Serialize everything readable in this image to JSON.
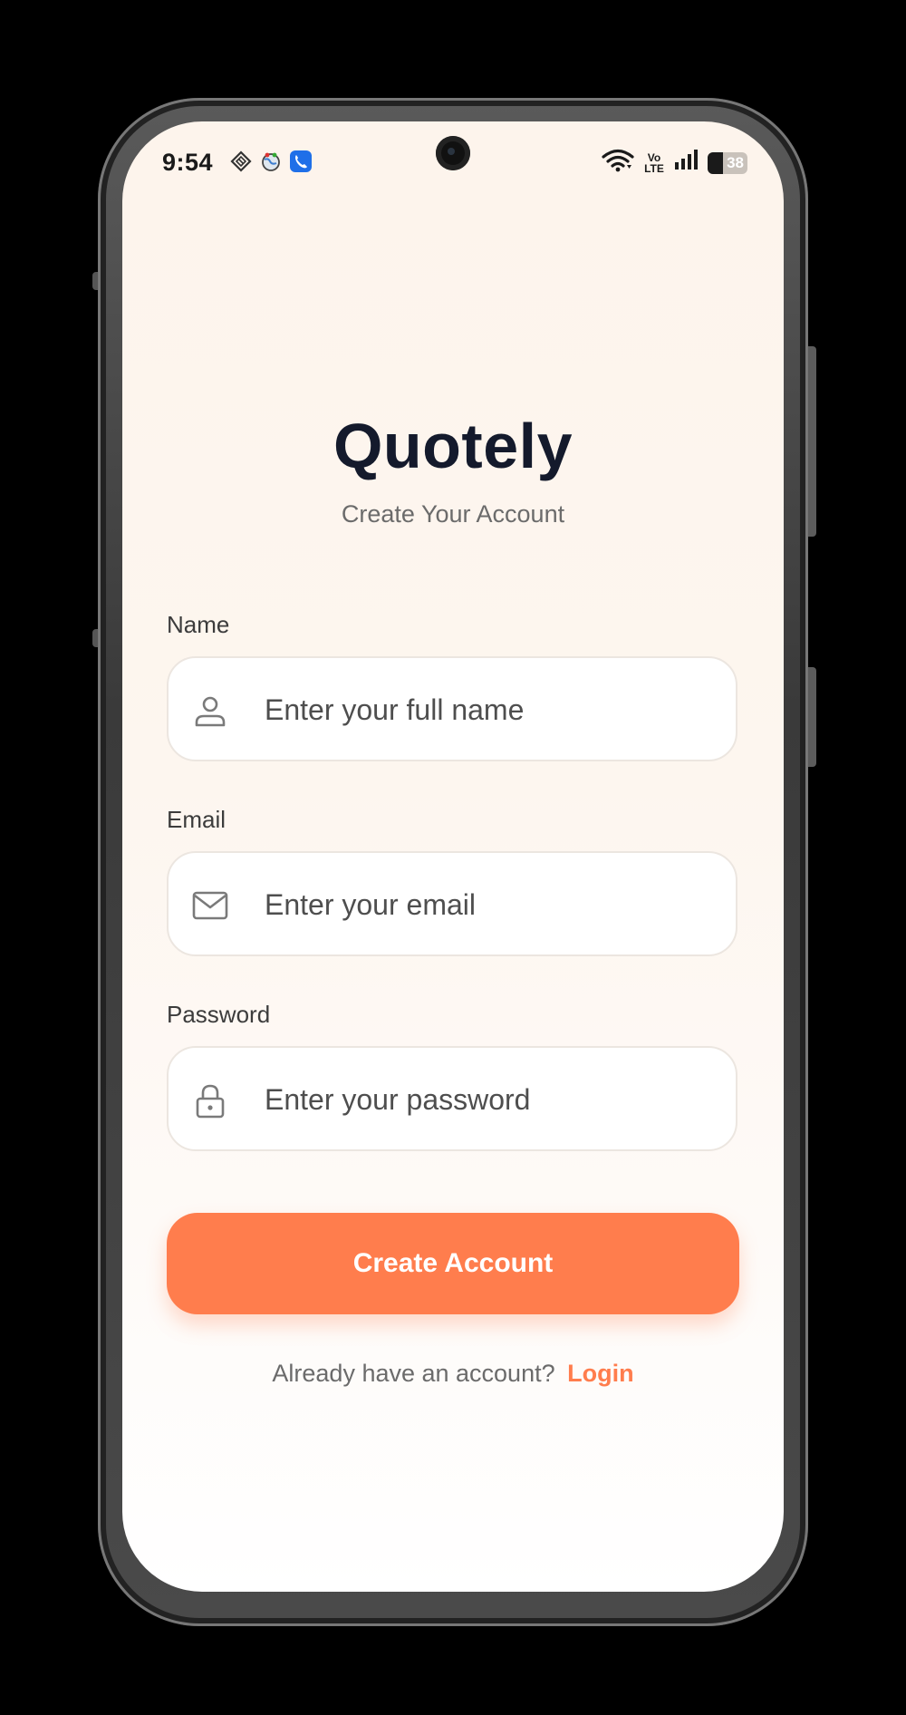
{
  "status_bar": {
    "time": "9:54",
    "battery_level": "38",
    "network_label_top": "Vo",
    "network_label_bottom": "LTE",
    "notification_icons": [
      "tag-icon",
      "globe-icon",
      "phone-app-icon"
    ]
  },
  "app": {
    "title": "Quotely",
    "subtitle": "Create Your Account"
  },
  "form": {
    "name": {
      "label": "Name",
      "placeholder": "Enter your full name",
      "value": "",
      "icon": "user-icon"
    },
    "email": {
      "label": "Email",
      "placeholder": "Enter your email",
      "value": "",
      "icon": "mail-icon"
    },
    "password": {
      "label": "Password",
      "placeholder": "Enter your password",
      "value": "",
      "icon": "lock-icon"
    },
    "submit_label": "Create Account"
  },
  "footer": {
    "prompt": "Already have an account?",
    "link_label": "Login"
  },
  "colors": {
    "accent": "#ff7d4d",
    "title": "#141a2c",
    "background_top": "#fdf4ec"
  }
}
